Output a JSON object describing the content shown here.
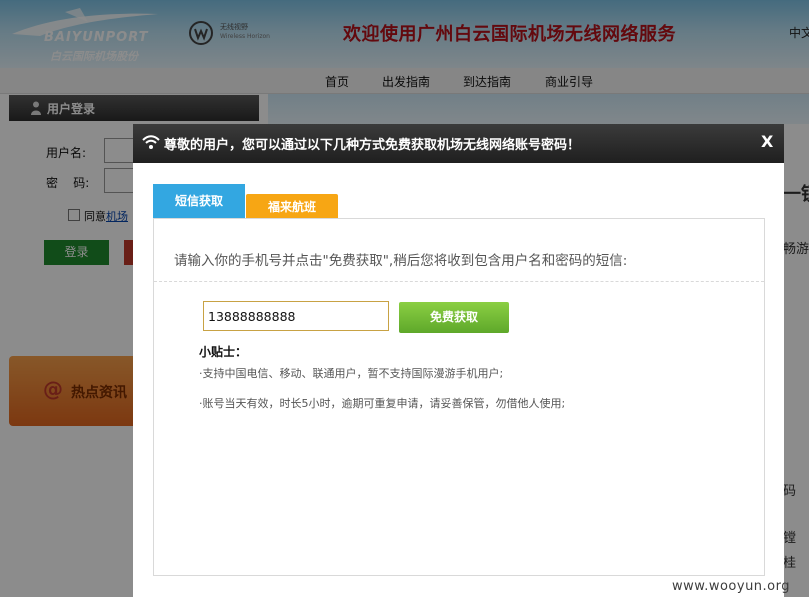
{
  "header": {
    "logo_en": "BAIYUNPORT",
    "logo_cn": "白云国际机场股份",
    "partner_logo_cn": "无线视野",
    "partner_logo_en": "Wireless Horizon",
    "banner_title": "欢迎使用广州白云国际机场无线网络服务",
    "language": "中文"
  },
  "nav": {
    "items": [
      "首页",
      "出发指南",
      "到达指南",
      "商业引导"
    ]
  },
  "login": {
    "title": "用户登录",
    "username_label": "用户名:",
    "password_label": "密    码:",
    "agree_text": "同意",
    "agree_link": "机场",
    "login_button": "登录"
  },
  "hot_news": {
    "icon": "@",
    "label": "热点资讯"
  },
  "background_side": {
    "fragments": [
      "一锁",
      "畅游",
      "码",
      "镗",
      "桂"
    ]
  },
  "modal": {
    "title": "尊敬的用户，您可以通过以下几种方式免费获取机场无线网络账号密码！",
    "close_label": "X",
    "tabs": [
      {
        "label": "短信获取",
        "active": true
      },
      {
        "label": "福来航班",
        "active": false
      }
    ],
    "instruction": "请输入你的手机号并点击\"免费获取\",稍后您将收到包含用户名和密码的短信:",
    "phone_value": "13888888888",
    "get_button": "免费获取",
    "tips_title": "小贴士：",
    "tips": [
      "·支持中国电信、移动、联通用户，暂不支持国际漫游手机用户;",
      "·账号当天有效，时长5小时，逾期可重复申请，请妥善保管，勿借他人使用;"
    ]
  },
  "watermark": "www.wooyun.org",
  "colors": {
    "tab_active": "#33a7e1",
    "tab_inactive": "#f7a614",
    "button_green": "#6cb832",
    "header_dark": "#2a2a2a",
    "banner_red": "#b5121b"
  }
}
